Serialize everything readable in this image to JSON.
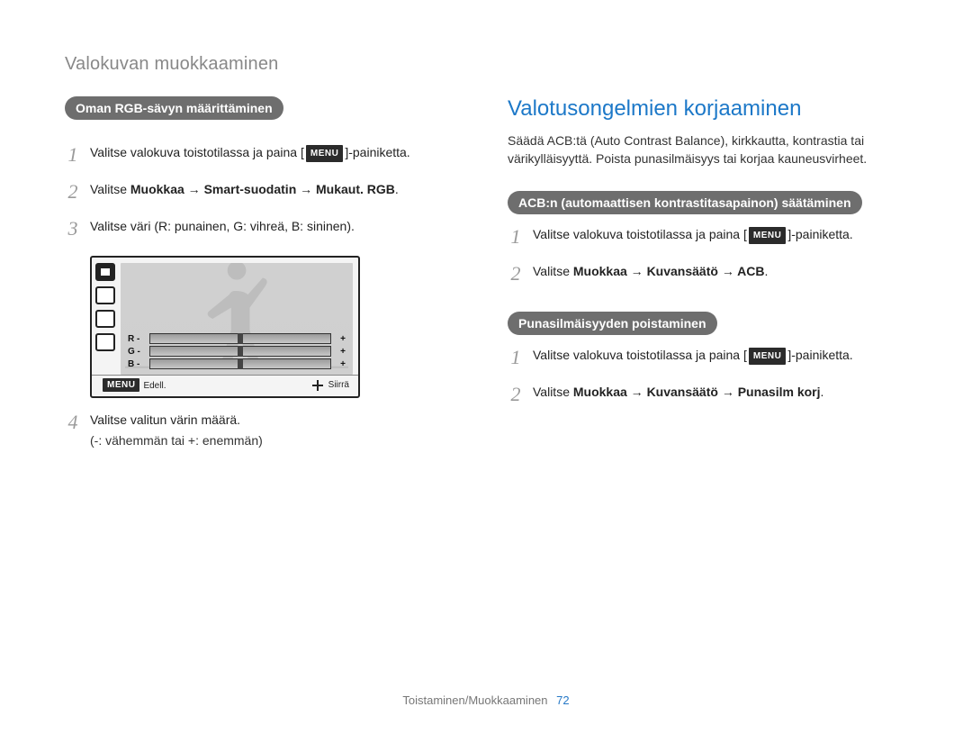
{
  "breadcrumb": "Valokuvan muokkaaminen",
  "menu_tag": "MENU",
  "left": {
    "badge": "Oman RGB-sävyn määrittäminen",
    "step1_pre": "Valitse valokuva toistotilassa ja paina [",
    "step1_post": "]-painiketta.",
    "step2_pre": "Valitse ",
    "step2_bold": "Muokkaa → Smart-suodatin → Mukaut. RGB",
    "step2_post": ".",
    "step3": "Valitse väri (R: punainen, G: vihreä, B: sininen).",
    "lcd": {
      "rows": [
        {
          "label": "R -",
          "plus": "+"
        },
        {
          "label": "G -",
          "plus": "+"
        },
        {
          "label": "B -",
          "plus": "+"
        }
      ],
      "back": "Edell.",
      "move": "Siirrä"
    },
    "step4_line1": "Valitse valitun värin määrä.",
    "step4_line2": "(-: vähemmän tai +: enemmän)"
  },
  "right": {
    "title": "Valotusongelmien korjaaminen",
    "intro": "Säädä ACB:tä (Auto Contrast Balance), kirkkautta, kontrastia tai värikylläisyyttä. Poista punasilmäisyys tai korjaa kauneusvirheet.",
    "acb": {
      "badge": "ACB:n (automaattisen kontrastitasapainon) säätäminen",
      "step1_pre": "Valitse valokuva toistotilassa ja paina [",
      "step1_post": "]-painiketta.",
      "step2_pre": "Valitse ",
      "step2_bold": "Muokkaa → Kuvansäätö → ACB",
      "step2_post": "."
    },
    "redeye": {
      "badge": "Punasilmäisyyden poistaminen",
      "step1_pre": "Valitse valokuva toistotilassa ja paina [",
      "step1_post": "]-painiketta.",
      "step2_pre": "Valitse ",
      "step2_bold": "Muokkaa → Kuvansäätö → Punasilm korj",
      "step2_post": "."
    }
  },
  "footer": {
    "section": "Toistaminen/Muokkaaminen",
    "page": "72"
  }
}
